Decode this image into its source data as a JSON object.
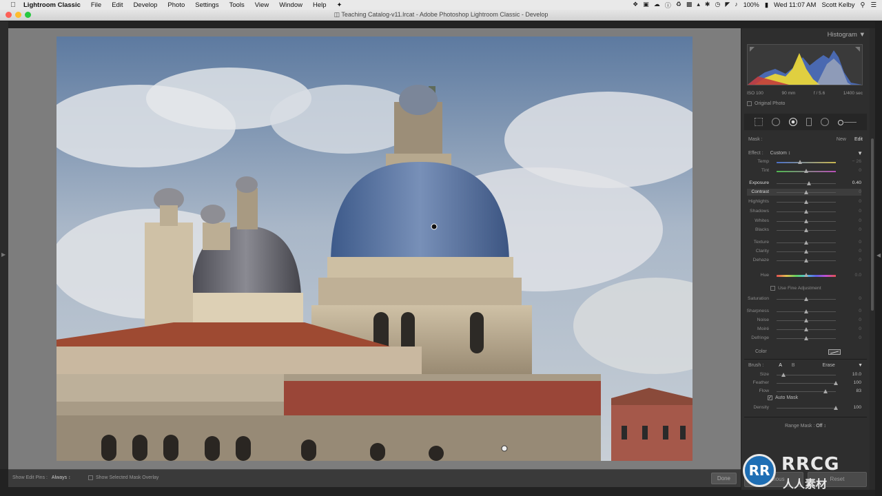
{
  "menubar": {
    "app_name": "Lightroom Classic",
    "items": [
      "File",
      "Edit",
      "Develop",
      "Photo",
      "Settings",
      "Tools",
      "View",
      "Window",
      "Help"
    ],
    "battery": "100%",
    "clock": "Wed 11:07 AM",
    "user": "Scott Kelby"
  },
  "window": {
    "title": "Teaching Catalog-v11.lrcat - Adobe Photoshop Lightroom Classic - Develop"
  },
  "toolbar": {
    "show_edit_pins_label": "Show Edit Pins :",
    "show_edit_pins_value": "Always",
    "show_mask_overlay_label": "Show Selected Mask Overlay",
    "done_label": "Done"
  },
  "panel": {
    "histogram_label": "Histogram",
    "exif": {
      "iso": "ISO 100",
      "focal": "90 mm",
      "aperture": "f / 5.6",
      "shutter": "1/400 sec"
    },
    "original_photo_label": "Original Photo",
    "mask_label": "Mask :",
    "mask_new": "New",
    "mask_edit": "Edit",
    "effect_label": "Effect :",
    "effect_value": "Custom",
    "sliders": {
      "temp": {
        "label": "Temp",
        "value": "− 26",
        "position": 0.39
      },
      "tint": {
        "label": "Tint",
        "value": "0",
        "position": 0.5
      },
      "exposure": {
        "label": "Exposure",
        "value": "0.40",
        "position": 0.55
      },
      "contrast": {
        "label": "Contrast",
        "value": "0",
        "position": 0.5
      },
      "highlights": {
        "label": "Highlights",
        "value": "0",
        "position": 0.5
      },
      "shadows": {
        "label": "Shadows",
        "value": "0",
        "position": 0.5
      },
      "whites": {
        "label": "Whites",
        "value": "0",
        "position": 0.5
      },
      "blacks": {
        "label": "Blacks",
        "value": "0",
        "position": 0.5
      },
      "texture": {
        "label": "Texture",
        "value": "0",
        "position": 0.5
      },
      "clarity": {
        "label": "Clarity",
        "value": "0",
        "position": 0.5
      },
      "dehaze": {
        "label": "Dehaze",
        "value": "0",
        "position": 0.5
      },
      "hue": {
        "label": "Hue",
        "value": "0.0",
        "position": 0.5
      },
      "saturation": {
        "label": "Saturation",
        "value": "0",
        "position": 0.5
      },
      "sharpness": {
        "label": "Sharpness",
        "value": "0",
        "position": 0.5
      },
      "noise": {
        "label": "Noise",
        "value": "0",
        "position": 0.5
      },
      "moire": {
        "label": "Moiré",
        "value": "0",
        "position": 0.5
      },
      "defringe": {
        "label": "Defringe",
        "value": "0",
        "position": 0.5
      }
    },
    "use_fine_adjustment_label": "Use Fine Adjustment",
    "color_label": "Color",
    "brush_label": "Brush :",
    "brush_a": "A",
    "brush_b": "B",
    "brush_erase": "Erase",
    "brush_sliders": {
      "size": {
        "label": "Size",
        "value": "10.0",
        "position": 0.12
      },
      "feather": {
        "label": "Feather",
        "value": "100",
        "position": 1.0
      },
      "flow": {
        "label": "Flow",
        "value": "83",
        "position": 0.83
      },
      "density": {
        "label": "Density",
        "value": "100",
        "position": 1.0
      }
    },
    "auto_mask_label": "Auto Mask",
    "range_mask_label": "Range Mask :",
    "range_mask_value": "Off",
    "previous_label": "Previous",
    "reset_label": "Reset"
  },
  "logo": {
    "badge": "RR",
    "brand": "RRCG",
    "sub": "人人素材"
  }
}
